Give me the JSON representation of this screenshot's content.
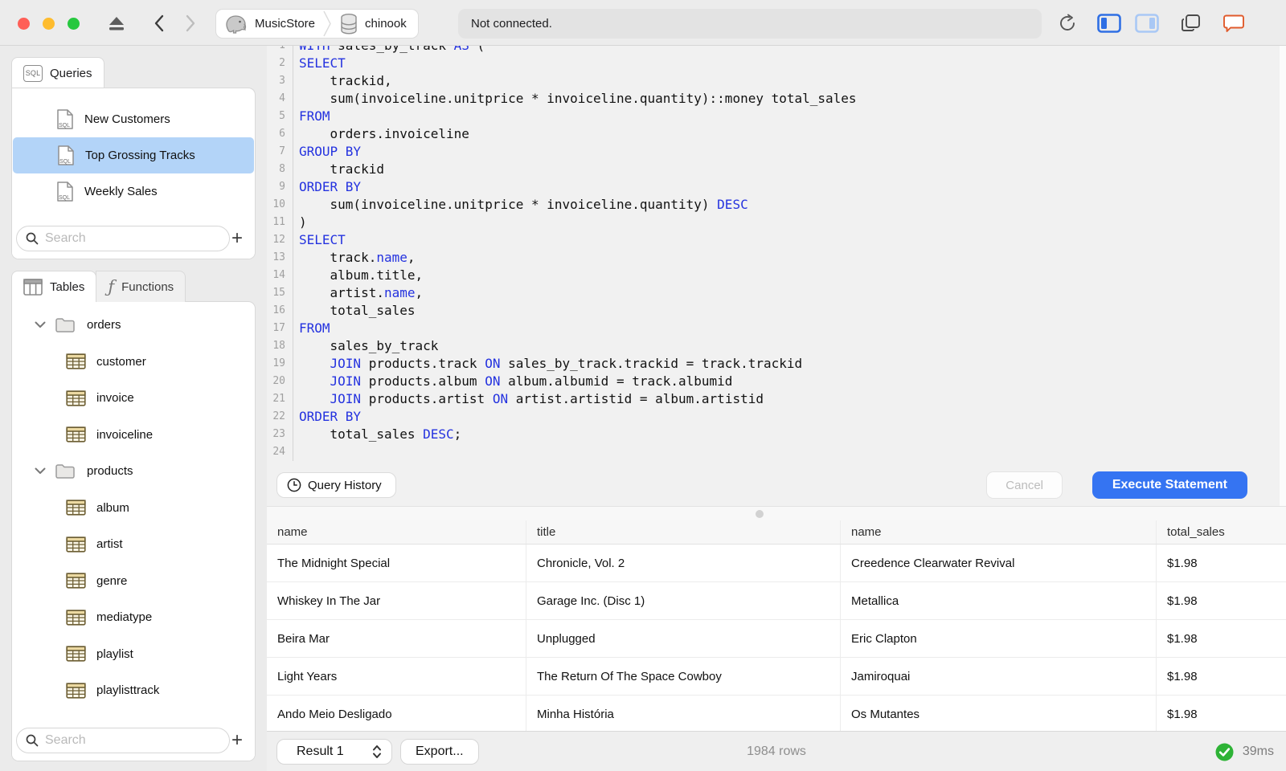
{
  "colors": {
    "accent": "#3574f2",
    "keyword_blue": "#2432df",
    "selection_blue": "#b3d4f8",
    "success_green": "#2eb336",
    "feedback_orange": "#e05a2b"
  },
  "titlebar": {
    "breadcrumb": {
      "server": "MusicStore",
      "database": "chinook"
    },
    "status_field": "Not connected."
  },
  "sidebar": {
    "queries_panel": {
      "tab_label": "Queries",
      "items": [
        {
          "label": "New Customers",
          "selected": false
        },
        {
          "label": "Top Grossing Tracks",
          "selected": true
        },
        {
          "label": "Weekly Sales",
          "selected": false
        }
      ],
      "search_placeholder": "Search",
      "add_label": "+"
    },
    "schema_panel": {
      "tabs": [
        {
          "label": "Tables",
          "active": true
        },
        {
          "label": "Functions",
          "active": false
        }
      ],
      "tree": [
        {
          "type": "folder",
          "label": "orders",
          "expanded": true,
          "children": [
            "customer",
            "invoice",
            "invoiceline"
          ]
        },
        {
          "type": "folder",
          "label": "products",
          "expanded": true,
          "children": [
            "album",
            "artist",
            "genre",
            "mediatype",
            "playlist",
            "playlisttrack"
          ]
        }
      ],
      "search_placeholder": "Search",
      "add_label": "+"
    }
  },
  "editor": {
    "lines": [
      [
        {
          "t": "WITH",
          "k": 1
        },
        {
          "t": " sales_by_track "
        },
        {
          "t": "AS",
          "k": 1
        },
        {
          "t": " ("
        }
      ],
      [
        {
          "t": "SELECT",
          "k": 1
        }
      ],
      [
        {
          "t": "    trackid,"
        }
      ],
      [
        {
          "t": "    sum(invoiceline.unitprice * invoiceline.quantity)::money total_sales"
        }
      ],
      [
        {
          "t": "FROM",
          "k": 1
        }
      ],
      [
        {
          "t": "    orders.invoiceline"
        }
      ],
      [
        {
          "t": "GROUP BY",
          "k": 1
        }
      ],
      [
        {
          "t": "    trackid"
        }
      ],
      [
        {
          "t": "ORDER BY",
          "k": 1
        }
      ],
      [
        {
          "t": "    sum(invoiceline.unitprice * invoiceline.quantity) "
        },
        {
          "t": "DESC",
          "k": 1
        }
      ],
      [
        {
          "t": ")"
        }
      ],
      [
        {
          "t": "SELECT",
          "k": 1
        }
      ],
      [
        {
          "t": "    track."
        },
        {
          "t": "name",
          "k": 1
        },
        {
          "t": ","
        }
      ],
      [
        {
          "t": "    album.title,"
        }
      ],
      [
        {
          "t": "    artist."
        },
        {
          "t": "name",
          "k": 1
        },
        {
          "t": ","
        }
      ],
      [
        {
          "t": "    total_sales"
        }
      ],
      [
        {
          "t": "FROM",
          "k": 1
        }
      ],
      [
        {
          "t": "    sales_by_track"
        }
      ],
      [
        {
          "t": "    "
        },
        {
          "t": "JOIN",
          "k": 1
        },
        {
          "t": " products.track "
        },
        {
          "t": "ON",
          "k": 1
        },
        {
          "t": " sales_by_track.trackid = track.trackid"
        }
      ],
      [
        {
          "t": "    "
        },
        {
          "t": "JOIN",
          "k": 1
        },
        {
          "t": " products.album "
        },
        {
          "t": "ON",
          "k": 1
        },
        {
          "t": " album.albumid = track.albumid"
        }
      ],
      [
        {
          "t": "    "
        },
        {
          "t": "JOIN",
          "k": 1
        },
        {
          "t": " products.artist "
        },
        {
          "t": "ON",
          "k": 1
        },
        {
          "t": " artist.artistid = album.artistid"
        }
      ],
      [
        {
          "t": "ORDER BY",
          "k": 1
        }
      ],
      [
        {
          "t": "    total_sales "
        },
        {
          "t": "DESC",
          "k": 1
        },
        {
          "t": ";"
        }
      ],
      [
        {
          "t": ""
        }
      ]
    ],
    "query_history_label": "Query History",
    "cancel_label": "Cancel",
    "execute_label": "Execute Statement"
  },
  "results": {
    "columns": [
      "name",
      "title",
      "name",
      "total_sales"
    ],
    "rows": [
      [
        "The Midnight Special",
        "Chronicle, Vol. 2",
        "Creedence Clearwater Revival",
        "$1.98"
      ],
      [
        "Whiskey In The Jar",
        "Garage Inc. (Disc 1)",
        "Metallica",
        "$1.98"
      ],
      [
        "Beira Mar",
        "Unplugged",
        "Eric Clapton",
        "$1.98"
      ],
      [
        "Light Years",
        "The Return Of The Space Cowboy",
        "Jamiroquai",
        "$1.98"
      ],
      [
        "Ando Meio Desligado",
        "Minha História",
        "Os Mutantes",
        "$1.98"
      ]
    ]
  },
  "statusbar": {
    "result_selector": "Result 1",
    "export_label": "Export...",
    "row_count": "1984 rows",
    "duration": "39ms"
  }
}
